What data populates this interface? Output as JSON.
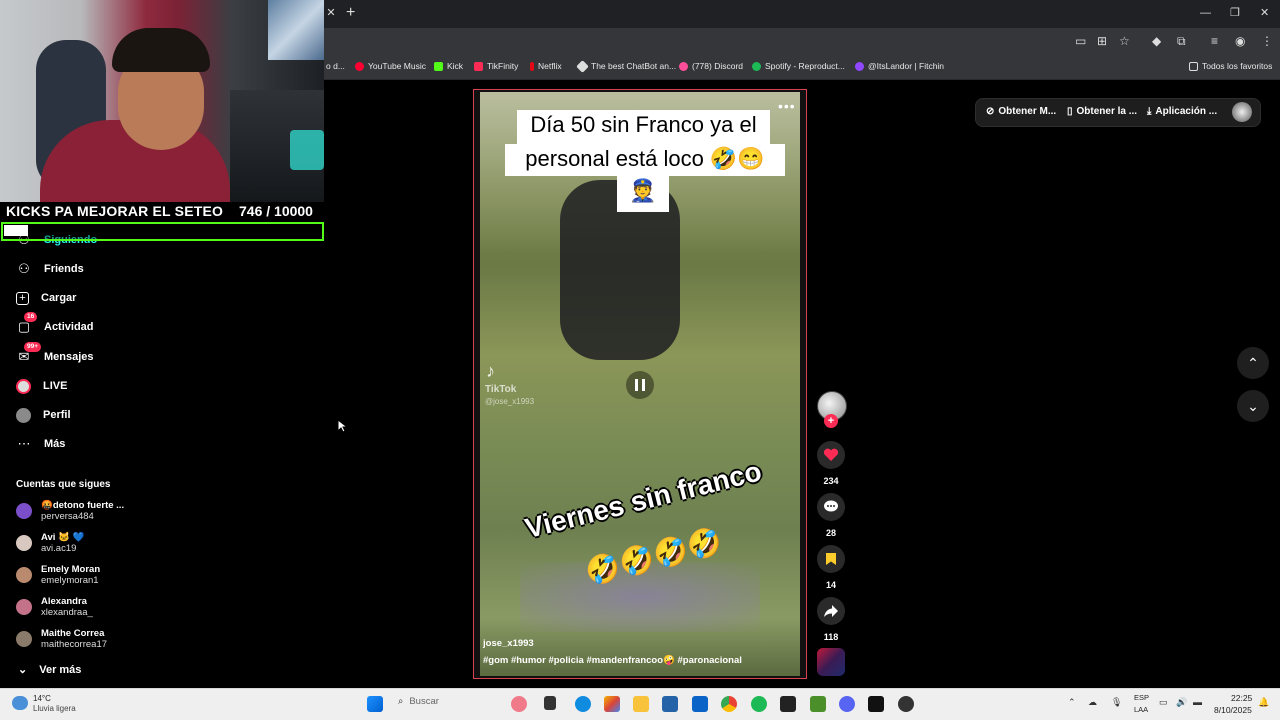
{
  "browser": {
    "bookmarks": [
      {
        "label": "o d...",
        "color": "#888888"
      },
      {
        "label": "YouTube Music",
        "color": "#ff0033"
      },
      {
        "label": "Kick",
        "color": "#53fc18"
      },
      {
        "label": "TikFinity",
        "color": "#fe2c55"
      },
      {
        "label": "Netflix",
        "color": "#e50914"
      },
      {
        "label": "The best ChatBot an...",
        "color": "#dddddd"
      },
      {
        "label": "(778) Discord",
        "color": "#ff4f9a"
      },
      {
        "label": "Spotify - Reproduct...",
        "color": "#1db954"
      },
      {
        "label": "@ItsLandor | Fitchin",
        "color": "#9146ff"
      }
    ],
    "bookmarks_folder": "Todos los favoritos"
  },
  "stream_overlay": {
    "goal_label": "KICKS PA MEJORAR EL SETEO",
    "goal_count": "746   / 10000",
    "goal_progress": 0.0746,
    "accent_color": "#53fc18"
  },
  "sidebar": {
    "nav": [
      {
        "label": "Siguiendo",
        "icon": "following-icon",
        "selected": true
      },
      {
        "label": "Friends",
        "icon": "friends-icon"
      },
      {
        "label": "Cargar",
        "icon": "upload-icon"
      },
      {
        "label": "Actividad",
        "icon": "activity-icon",
        "badge": "16"
      },
      {
        "label": "Mensajes",
        "icon": "messages-icon",
        "badge": "99+"
      },
      {
        "label": "LIVE",
        "icon": "live-icon"
      },
      {
        "label": "Perfil",
        "icon": "profile-icon"
      },
      {
        "label": "Más",
        "icon": "more-icon"
      }
    ],
    "following_heading": "Cuentas que sigues",
    "accounts": [
      {
        "name": "🤬detono fuerte ...",
        "handle": "perversa484",
        "color": "#7a4fc9"
      },
      {
        "name": "Avi 🐱 💙",
        "handle": "avi.ac19",
        "color": "#d8c8c0"
      },
      {
        "name": "Emely Moran",
        "handle": "emelymoran1",
        "color": "#b98a6e"
      },
      {
        "name": "Alexandra",
        "handle": "xlexandraa_",
        "color": "#c4728a"
      },
      {
        "name": "Maithe Correa",
        "handle": "maithecorrea17",
        "color": "#8a7a6a"
      }
    ],
    "see_more": "Ver más"
  },
  "video": {
    "caption_line1": "Día 50 sin Franco ya el",
    "caption_line2": "personal está loco 🤣😁",
    "caption_line3": "👮",
    "tiktok_watermark": "TikTok",
    "watermark_handle": "@jose_x1993",
    "overlay_text": "Viernes sin franco",
    "overlay_emoji": "🤣🤣🤣🤣",
    "author": "jose_x1993",
    "hashtags": "#gom  #humor  #policia  #mandenfrancoo🤪  #paronacional"
  },
  "actions": {
    "likes": "234",
    "comments": "28",
    "saves": "14",
    "shares": "118"
  },
  "top_actions": {
    "item1": "Obtener M...",
    "item2": "Obtener la ...",
    "item3": "Aplicación ..."
  },
  "taskbar": {
    "temperature": "14°C",
    "weather": "Lluvia ligera",
    "search": "Buscar",
    "lang_line1": "ESP",
    "lang_line2": "LAA",
    "time": "22:25",
    "date": "8/10/2025"
  }
}
